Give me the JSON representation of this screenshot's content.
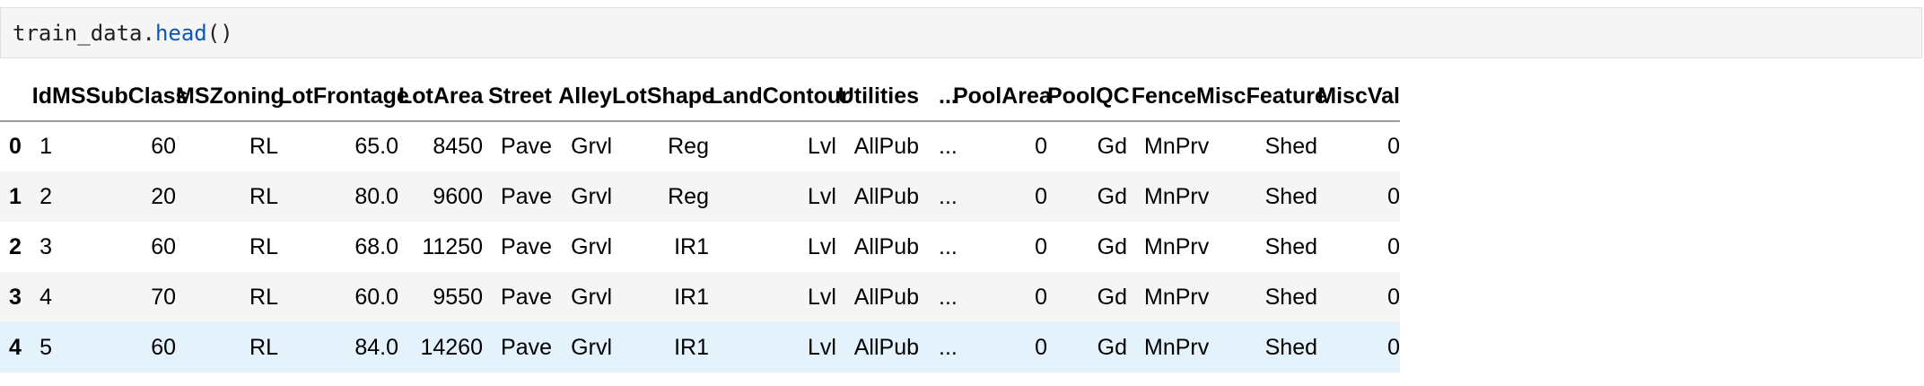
{
  "cell": {
    "code_object": "train_data.",
    "code_method": "head",
    "code_parens": "()"
  },
  "table": {
    "index_header": "",
    "columns": [
      "Id",
      "MSSubClass",
      "MSZoning",
      "LotFrontage",
      "LotArea",
      "Street",
      "Alley",
      "LotShape",
      "LandContour",
      "Utilities",
      "...",
      "PoolArea",
      "PoolQC",
      "Fence",
      "MiscFeature",
      "MiscVal"
    ],
    "rows": [
      {
        "index": "0",
        "cells": [
          "1",
          "60",
          "RL",
          "65.0",
          "8450",
          "Pave",
          "Grvl",
          "Reg",
          "Lvl",
          "AllPub",
          "...",
          "0",
          "Gd",
          "MnPrv",
          "Shed",
          "0"
        ]
      },
      {
        "index": "1",
        "cells": [
          "2",
          "20",
          "RL",
          "80.0",
          "9600",
          "Pave",
          "Grvl",
          "Reg",
          "Lvl",
          "AllPub",
          "...",
          "0",
          "Gd",
          "MnPrv",
          "Shed",
          "0"
        ]
      },
      {
        "index": "2",
        "cells": [
          "3",
          "60",
          "RL",
          "68.0",
          "11250",
          "Pave",
          "Grvl",
          "IR1",
          "Lvl",
          "AllPub",
          "...",
          "0",
          "Gd",
          "MnPrv",
          "Shed",
          "0"
        ]
      },
      {
        "index": "3",
        "cells": [
          "4",
          "70",
          "RL",
          "60.0",
          "9550",
          "Pave",
          "Grvl",
          "IR1",
          "Lvl",
          "AllPub",
          "...",
          "0",
          "Gd",
          "MnPrv",
          "Shed",
          "0"
        ]
      },
      {
        "index": "4",
        "cells": [
          "5",
          "60",
          "RL",
          "84.0",
          "14260",
          "Pave",
          "Grvl",
          "IR1",
          "Lvl",
          "AllPub",
          "...",
          "0",
          "Gd",
          "MnPrv",
          "Shed",
          "0"
        ]
      }
    ]
  },
  "colors": {
    "code_method": "#0b58b3",
    "stripe_row": "#f5f5f5",
    "hover_row": "#e4f2fc",
    "header_border": "#9e9e9e"
  }
}
